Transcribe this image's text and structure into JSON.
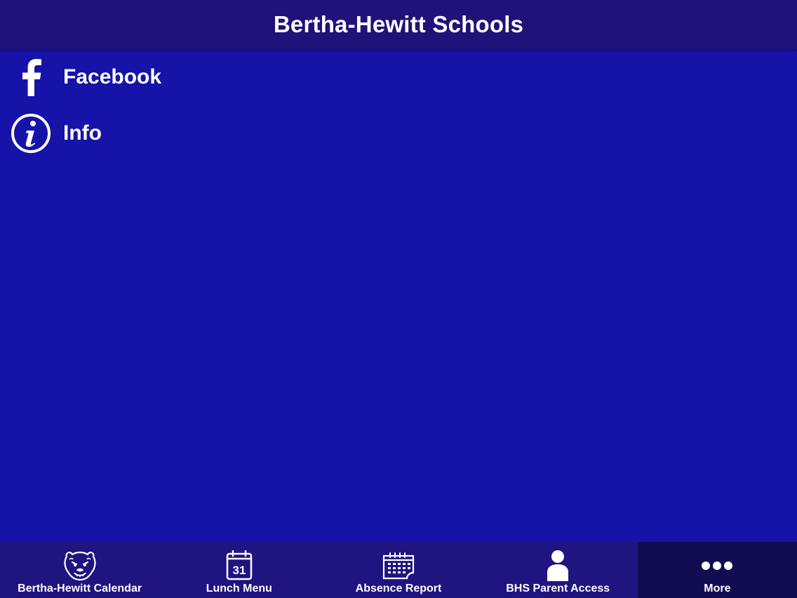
{
  "app": {
    "title": "Bertha-Hewitt Schools"
  },
  "menu": {
    "items": [
      {
        "label": "Facebook",
        "icon": "facebook-icon"
      },
      {
        "label": "Info",
        "icon": "info-icon"
      }
    ]
  },
  "tabbar": {
    "tabs": [
      {
        "label": "Bertha-Hewitt Calendar",
        "icon": "bear-logo-icon",
        "active": false
      },
      {
        "label": "Lunch Menu",
        "icon": "calendar-icon",
        "calendar_day": "31",
        "active": false
      },
      {
        "label": "Absence Report",
        "icon": "calendar-grid-icon",
        "active": false
      },
      {
        "label": "BHS Parent Access",
        "icon": "person-icon",
        "active": false
      },
      {
        "label": "More",
        "icon": "more-dots-icon",
        "active": true
      }
    ]
  },
  "colors": {
    "background": "#1614a8",
    "header": "#21127a",
    "tabbar": "#1f1480",
    "tab_active": "#120d52",
    "text": "#ffffff"
  }
}
